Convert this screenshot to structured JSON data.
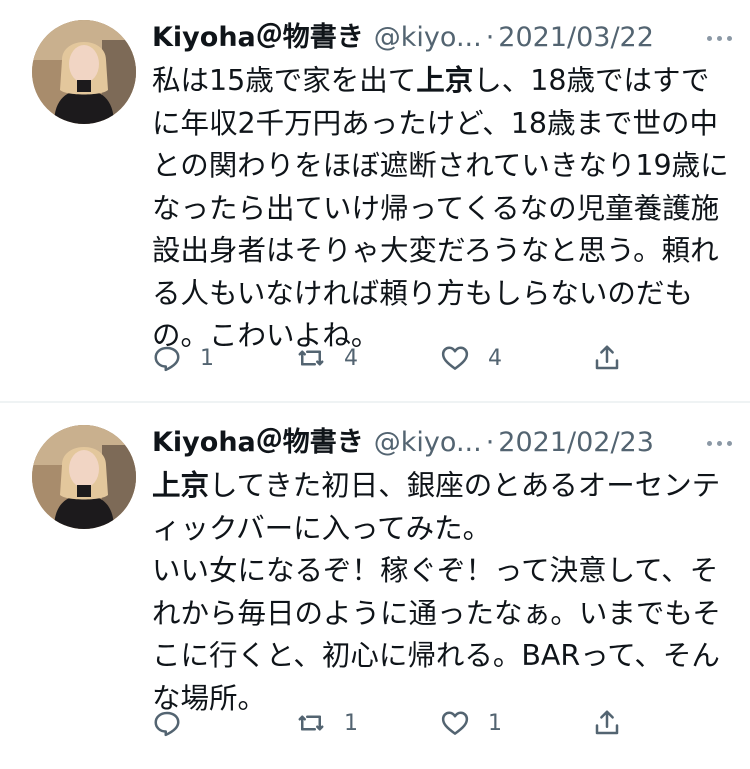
{
  "tweets": [
    {
      "author_name": "Kiyoha＠物書き",
      "handle": "@kiyo...",
      "separator": "·",
      "date": "2021/03/22",
      "text_before": "私は15歳で家を出て",
      "text_bold": "上京",
      "text_after": "し、18歳ではすでに年収2千万円あったけど、18歳まで世の中との関わりをほぼ遮断されていきなり19歳になったら出ていけ帰ってくるなの児童養護施設出身者はそりゃ大変だろうなと思う。頼れる人もいなければ頼り方もしらないのだもの。こわいよね。",
      "replies": "1",
      "retweets": "4",
      "likes": "4",
      "icons": [
        "reply-icon",
        "retweet-icon",
        "like-icon",
        "share-icon",
        "more-icon"
      ]
    },
    {
      "author_name": "Kiyoha＠物書き",
      "handle": "@kiyo...",
      "separator": "·",
      "date": "2021/02/23",
      "text_before": "",
      "text_bold": "上京",
      "text_after": "してきた初日、銀座のとあるオーセンティックバーに入ってみた。\nいい女になるぞ！稼ぐぞ！って決意して、それから毎日のように通ったなぁ。いまでもそこに行くと、初心に帰れる。BARって、そんな場所。",
      "replies": "",
      "retweets": "1",
      "likes": "1",
      "icons": [
        "reply-icon",
        "retweet-icon",
        "like-icon",
        "share-icon",
        "more-icon"
      ]
    }
  ],
  "colors": {
    "text": "#0f1419",
    "secondary": "#536471",
    "divider": "#eff3f4"
  }
}
